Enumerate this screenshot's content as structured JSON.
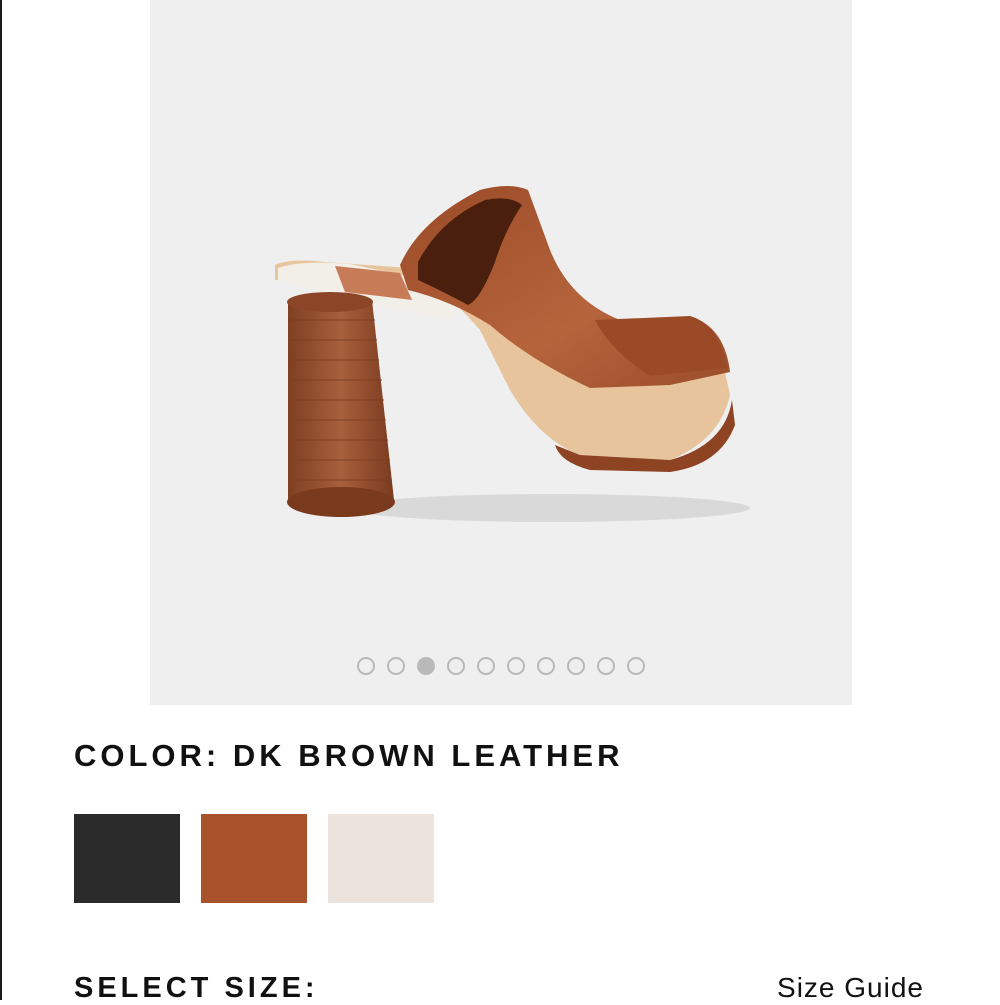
{
  "product": {
    "color_prefix": "COLOR: ",
    "color_name": "DK BROWN LEATHER"
  },
  "gallery": {
    "image_count": 10,
    "active_index": 2,
    "dot_color": "#b9b9b9",
    "background": "#efefef"
  },
  "swatches": [
    {
      "name": "black",
      "color": "#2b2b2b"
    },
    {
      "name": "dk-brown-leather",
      "color": "#a8532c"
    },
    {
      "name": "ivory",
      "color": "#ede3dd"
    }
  ],
  "size": {
    "label": "SELECT SIZE:",
    "guide_label": "Size Guide"
  },
  "colors": {
    "leather": "#a8532c",
    "heel_wood": "#9a5a3a",
    "text": "#111111"
  }
}
